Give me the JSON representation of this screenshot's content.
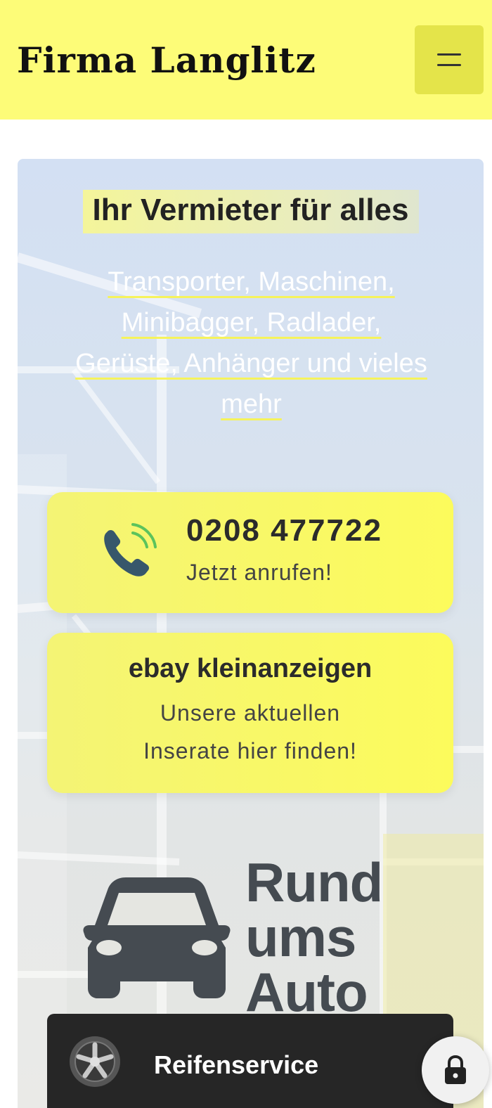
{
  "header": {
    "brand": "Firma Langlitz",
    "menu_icon": "hamburger-icon"
  },
  "hero": {
    "headline": "Ihr Vermieter für alles",
    "subtitle_lines": [
      "Transporter, Maschinen,",
      "Minibagger, Radlader,",
      "Gerüste, Anhänger und vieles",
      "mehr"
    ]
  },
  "phone_card": {
    "icon": "phone-icon",
    "number": "0208 477722",
    "cta": "Jetzt anrufen!"
  },
  "ebay_card": {
    "title": "ebay kleinanzeigen",
    "line1": "Unsere aktuellen",
    "line2": "Inserate hier finden!"
  },
  "auto": {
    "icon": "car-icon",
    "lines": [
      "Rund",
      "ums",
      "Auto"
    ]
  },
  "service": {
    "icon": "wheel-icon",
    "label": "Reifenservice"
  },
  "floating": {
    "icon": "lock-icon"
  },
  "colors": {
    "header_bg": "#fdfc78",
    "card_yellow": "#fcfb5c",
    "underline_yellow": "#f6f35b",
    "dark_bar": "#262626",
    "phone_icon_blue": "#37576b",
    "phone_wave_green": "#5cc35c",
    "car_gray": "#454b51"
  }
}
